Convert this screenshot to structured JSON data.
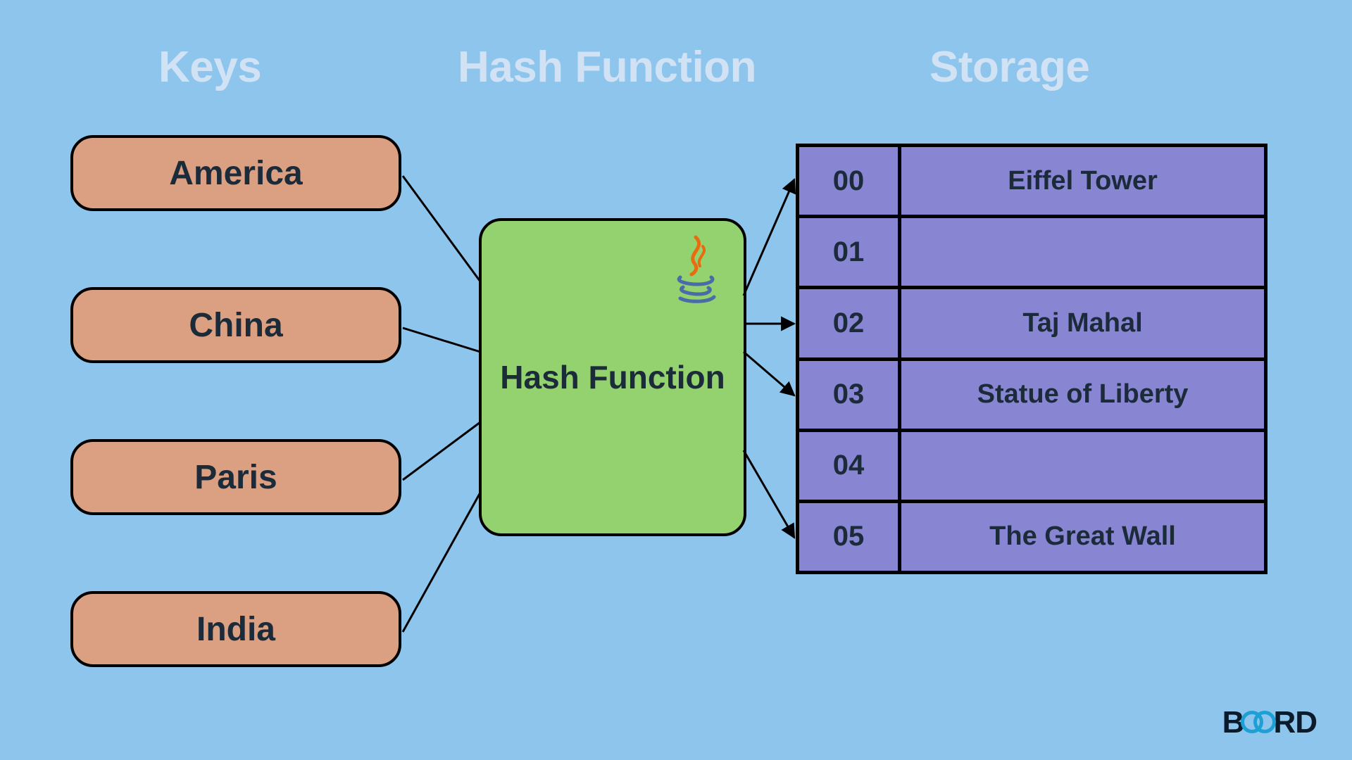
{
  "headers": {
    "keys": "Keys",
    "hash": "Hash Function",
    "storage": "Storage"
  },
  "keys": [
    "America",
    "China",
    "Paris",
    "India"
  ],
  "hash_label": "Hash Function",
  "storage_rows": [
    {
      "index": "00",
      "value": "Eiffel Tower"
    },
    {
      "index": "01",
      "value": ""
    },
    {
      "index": "02",
      "value": "Taj Mahal"
    },
    {
      "index": "03",
      "value": "Statue of Liberty"
    },
    {
      "index": "04",
      "value": ""
    },
    {
      "index": "05",
      "value": "The Great Wall"
    }
  ],
  "brand_prefix": "B",
  "brand_suffix": "RD",
  "java_icon_name": "java-logo-icon"
}
